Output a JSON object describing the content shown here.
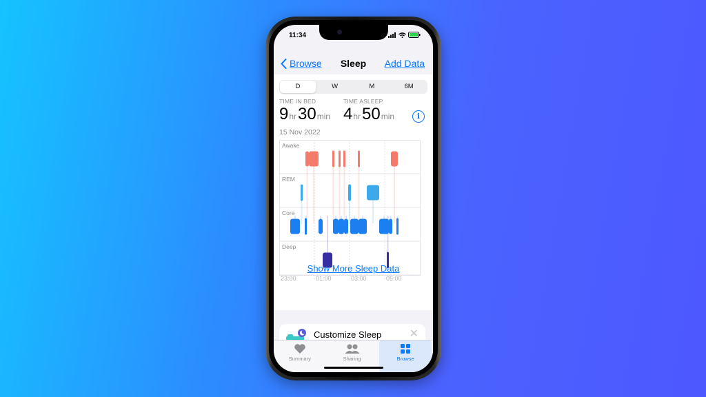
{
  "status": {
    "time": "11:34"
  },
  "nav": {
    "back_label": "Browse",
    "title": "Sleep",
    "action_label": "Add Data"
  },
  "segments": [
    "D",
    "W",
    "M",
    "6M"
  ],
  "selected_segment": "D",
  "stats": {
    "bed_label": "TIME IN BED",
    "bed_hr": "9",
    "bed_hr_unit": "hr",
    "bed_min": "30",
    "bed_min_unit": "min",
    "asleep_label": "TIME ASLEEP",
    "asleep_hr": "4",
    "asleep_hr_unit": "hr",
    "asleep_min": "50",
    "asleep_min_unit": "min"
  },
  "date": "15 Nov 2022",
  "chart_data": {
    "type": "bar",
    "stages": [
      "Awake",
      "REM",
      "Core",
      "Deep"
    ],
    "x_ticks": [
      "23:00",
      "01:00",
      "03:00",
      "05:00"
    ],
    "colors": {
      "Awake": "#f47a6b",
      "REM": "#3ba9ea",
      "Core": "#1b7ff0",
      "Deep": "#372ea2"
    }
  },
  "show_more_label": "Show More Sleep Data",
  "customize": {
    "title": "Customize Sleep"
  },
  "tabs": [
    {
      "label": "Summary",
      "icon": "heart-icon"
    },
    {
      "label": "Sharing",
      "icon": "people-icon"
    },
    {
      "label": "Browse",
      "icon": "grid-icon"
    }
  ]
}
